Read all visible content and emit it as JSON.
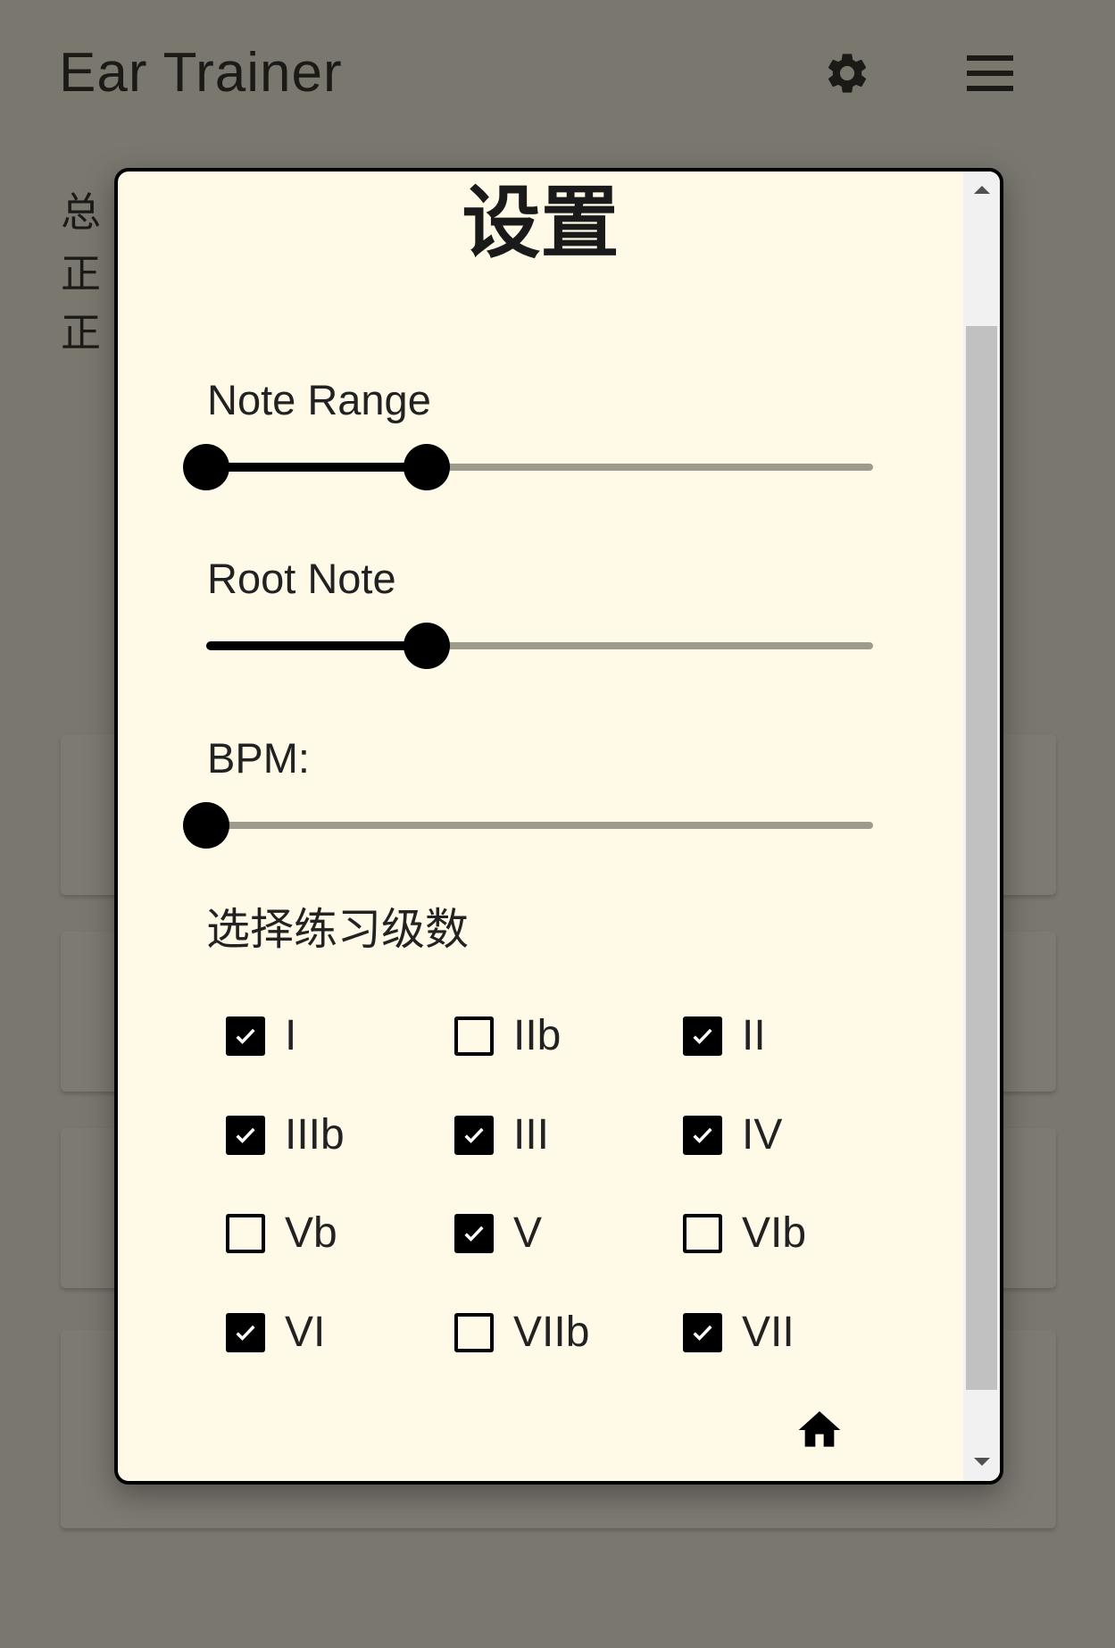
{
  "app": {
    "title": "Ear Trainer",
    "settings_icon": "gear-icon",
    "menu_icon": "menu-icon"
  },
  "background_stats": [
    "总",
    "正",
    "正"
  ],
  "settings_dialog": {
    "title": "设置",
    "note_range": {
      "label": "Note Range",
      "low": 0,
      "high": 0.33
    },
    "root_note": {
      "label": "Root Note",
      "value": 0.33
    },
    "bpm": {
      "label": "BPM:",
      "value": 0
    },
    "degrees_label": "选择练习级数",
    "degrees": [
      {
        "label": "I",
        "checked": true
      },
      {
        "label": "IIb",
        "checked": false
      },
      {
        "label": "II",
        "checked": true
      },
      {
        "label": "IIIb",
        "checked": true
      },
      {
        "label": "III",
        "checked": true
      },
      {
        "label": "IV",
        "checked": true
      },
      {
        "label": "Vb",
        "checked": false
      },
      {
        "label": "V",
        "checked": true
      },
      {
        "label": "VIb",
        "checked": false
      },
      {
        "label": "VI",
        "checked": true
      },
      {
        "label": "VIIb",
        "checked": false
      },
      {
        "label": "VII",
        "checked": true
      }
    ],
    "home_icon": "home-icon"
  },
  "colors": {
    "page_background": "#7a776f",
    "dialog_background": "#fffae8",
    "slider_active": "#000000",
    "slider_track": "#9d9b8c",
    "checkbox": "#000000"
  }
}
